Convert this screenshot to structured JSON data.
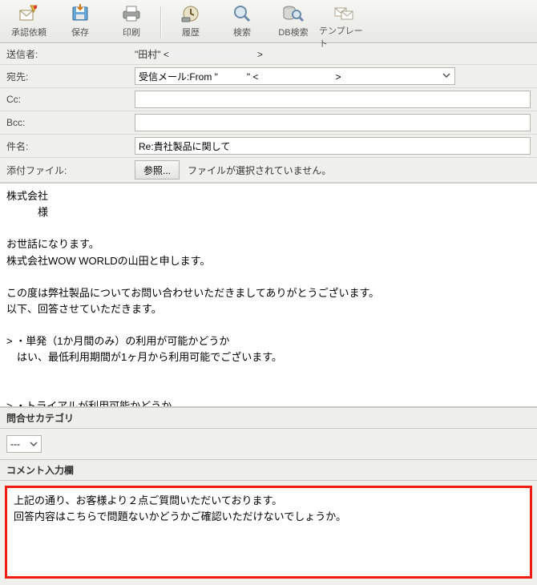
{
  "toolbar": {
    "approve": "承認依頼",
    "save": "保存",
    "print": "印刷",
    "history": "履歴",
    "search": "検索",
    "dbsearch": "DB検索",
    "template": "テンプレート"
  },
  "fields": {
    "sender_label": "送信者:",
    "sender_prefix": "\"田村\" <",
    "sender_suffix": ">",
    "to_label": "宛先:",
    "to_value": "受信メール:From \"　　　\" <　　　　　　　　>",
    "cc_label": "Cc:",
    "cc_value": "",
    "bcc_label": "Bcc:",
    "bcc_value": "",
    "subject_label": "件名:",
    "subject_value": "Re:貴社製品に関して",
    "attach_label": "添付ファイル:",
    "browse_label": "参照...",
    "attach_note": "ファイルが選択されていません。"
  },
  "body": "株式会社\n　　　様\n\nお世話になります。\n株式会社WOW WORLDの山田と申します。\n\nこの度は弊社製品についてお問い合わせいただきましてありがとうございます。\n以下、回答させていただきます。\n\n> ・単発（1か月間のみ）の利用が可能かどうか\n　はい、最低利用期間が1ヶ月から利用可能でございます。\n\n\n> ・トライアルが利用可能かどうか\n　はい、無料トライアルにつきましてもご利用可能でございます。\n",
  "category": {
    "header": "問合せカテゴリ",
    "selected": "---"
  },
  "comment": {
    "header": "コメント入力欄",
    "text": "上記の通り、お客様より２点ご質問いただいております。\n回答内容はこちらで問題ないかどうかご確認いただけないでしょうか。"
  }
}
